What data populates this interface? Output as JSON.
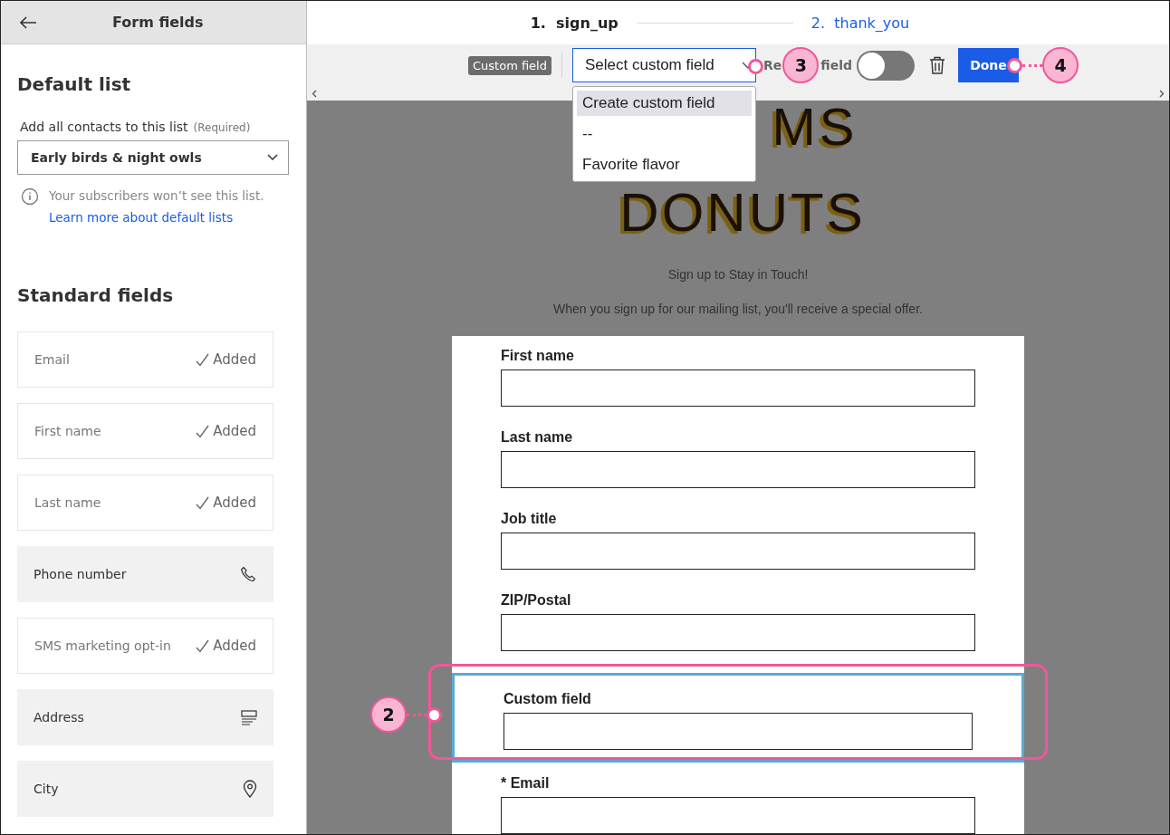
{
  "sidebar": {
    "title": "Form fields",
    "default_list": {
      "heading": "Default list",
      "label": "Add all contacts to this list",
      "required": "(Required)",
      "value": "Early birds & night owls",
      "note": "Your subscribers won’t see this list.",
      "link": "Learn more about default lists"
    },
    "standard_heading": "Standard fields",
    "fields": [
      {
        "label": "Email",
        "kind": "added",
        "status": "Added"
      },
      {
        "label": "First name",
        "kind": "added",
        "status": "Added"
      },
      {
        "label": "Last name",
        "kind": "added",
        "status": "Added"
      },
      {
        "label": "Phone number",
        "kind": "phone"
      },
      {
        "label": "SMS marketing opt-in",
        "kind": "added",
        "status": "Added"
      },
      {
        "label": "Address",
        "kind": "address"
      },
      {
        "label": "City",
        "kind": "location"
      }
    ]
  },
  "steps": [
    {
      "number": "1.",
      "label": "sign_up",
      "selected": true
    },
    {
      "number": "2.",
      "label": "thank_you",
      "selected": false
    }
  ],
  "toolbar": {
    "tag": "Custom field",
    "select": "Select custom field",
    "required_parts": [
      "Re",
      "field"
    ],
    "required_on": false,
    "done": "Done"
  },
  "dropdown": [
    {
      "label": "Create custom field",
      "selected": true
    },
    {
      "label": "--",
      "selected": false
    },
    {
      "label": "Favorite flavor",
      "selected": false
    }
  ],
  "preview": {
    "logo": [
      "MS",
      "DONUTS"
    ],
    "heading": "Sign up to Stay in Touch!",
    "intro": "When you sign up for our mailing list, you'll receive a special offer.",
    "fields": [
      {
        "label": "First name",
        "selected": false
      },
      {
        "label": "Last name",
        "selected": false
      },
      {
        "label": "Job title",
        "selected": false
      },
      {
        "label": "ZIP/Postal",
        "selected": false
      },
      {
        "label": "Custom field",
        "selected": true
      },
      {
        "label": "* Email",
        "selected": false
      }
    ]
  },
  "callouts": [
    "2",
    "3",
    "4"
  ]
}
